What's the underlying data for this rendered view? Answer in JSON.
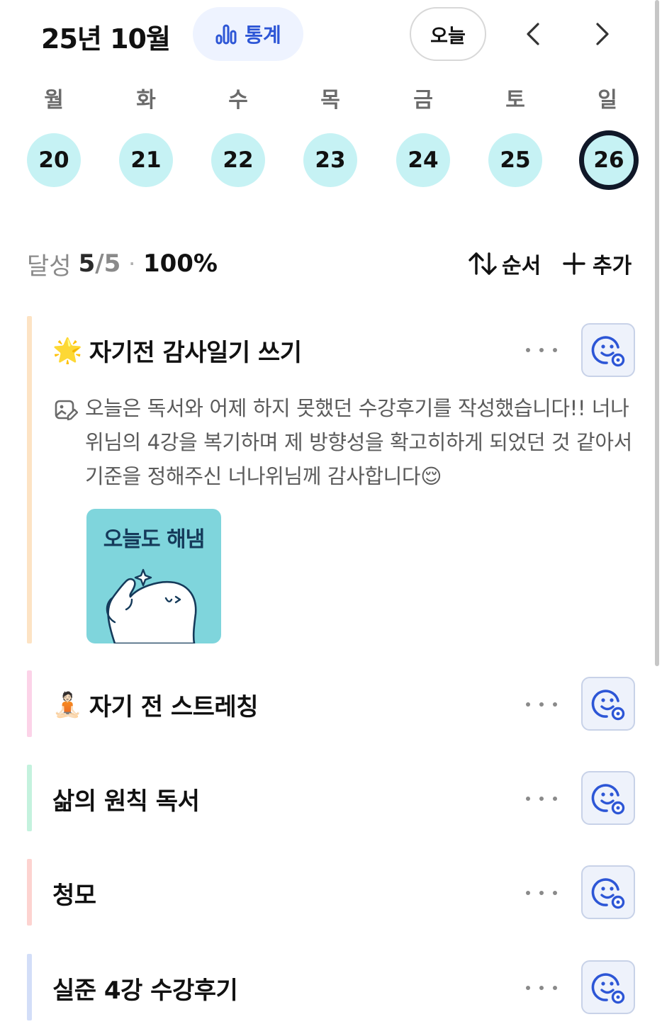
{
  "header": {
    "title": "25년 10월",
    "stats_label": "통계",
    "today_label": "오늘"
  },
  "week": {
    "days": [
      {
        "label": "월",
        "date": "20",
        "selected": false
      },
      {
        "label": "화",
        "date": "21",
        "selected": false
      },
      {
        "label": "수",
        "date": "22",
        "selected": false
      },
      {
        "label": "목",
        "date": "23",
        "selected": false
      },
      {
        "label": "금",
        "date": "24",
        "selected": false
      },
      {
        "label": "토",
        "date": "25",
        "selected": false
      },
      {
        "label": "일",
        "date": "26",
        "selected": true
      }
    ]
  },
  "summary": {
    "label": "달성",
    "done": "5",
    "separator": "/",
    "total": "5",
    "dot": "·",
    "percent": "100%",
    "sort_label": "순서",
    "add_label": "추가"
  },
  "habits": [
    {
      "emoji": "🌟",
      "title": "자기전 감사일기 쓰기",
      "color": "#fde3c4",
      "memo": "오늘은 독서와 어제 하지 못했던 수강후기를 작성했습니다!! 너나위님의 4강을 복기하며 제 방향성을 확고히하게 되었던 것 같아서 기준을 정해주신 너나위님께 감사합니다😌",
      "sticker_text": "오늘도 해냄"
    },
    {
      "emoji": "🧘🏻",
      "title": "자기 전 스트레칭",
      "color": "#fcd3e8"
    },
    {
      "emoji": "",
      "title": "삶의 원칙 독서",
      "color": "#c4f2de"
    },
    {
      "emoji": "",
      "title": "청모",
      "color": "#fdd3d0"
    },
    {
      "emoji": "",
      "title": "실준 4강 수강후기",
      "color": "#d3def8"
    }
  ],
  "colors": {
    "accent": "#2d56d6",
    "day_circle": "#c6f2f4",
    "selected_ring": "#101828",
    "mood_icon": "#2d56d6"
  },
  "icons": {
    "stats": "bar-chart-icon",
    "prev": "chevron-left-icon",
    "next": "chevron-right-icon",
    "sort": "sort-arrows-icon",
    "add": "plus-icon",
    "more": "more-horizontal-icon",
    "mood": "smile-add-icon",
    "memo": "image-edit-icon"
  }
}
